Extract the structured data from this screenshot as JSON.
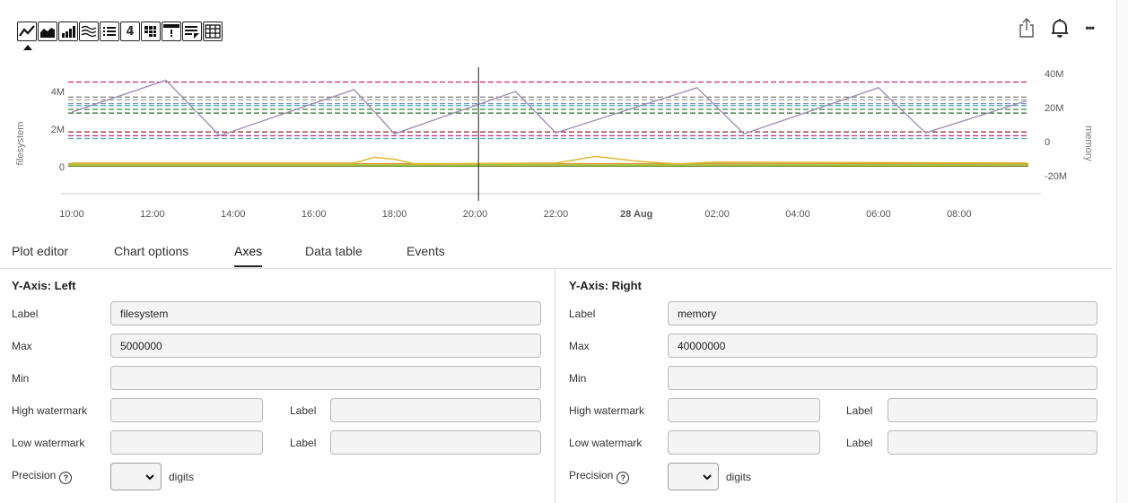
{
  "toolbar": {
    "buttons": [
      {
        "icon": "line-chart-icon"
      },
      {
        "icon": "area-chart-icon"
      },
      {
        "icon": "column-chart-icon"
      },
      {
        "icon": "heatmap-icon"
      },
      {
        "icon": "list-icon"
      },
      {
        "icon": "single-value-icon",
        "text": "4"
      },
      {
        "icon": "grid-icon"
      },
      {
        "icon": "alert-icon"
      },
      {
        "icon": "text-note-icon"
      },
      {
        "icon": "table-icon"
      }
    ],
    "selected_index": 0
  },
  "top_actions": [
    {
      "icon": "share-icon"
    },
    {
      "icon": "bell-icon"
    },
    {
      "icon": "more-icon",
      "text": "•••"
    }
  ],
  "chart_data": {
    "type": "line",
    "x_ticks": [
      "10:00",
      "12:00",
      "14:00",
      "16:00",
      "18:00",
      "20:00",
      "22:00",
      "28 Aug",
      "02:00",
      "04:00",
      "06:00",
      "08:00"
    ],
    "y_left": {
      "label": "filesystem",
      "ticks": [
        "4M",
        "2M",
        "0"
      ],
      "ylim": [
        0,
        5000000
      ]
    },
    "y_right": {
      "label": "memory",
      "ticks": [
        "40M",
        "20M",
        "0",
        "-20M"
      ],
      "ylim": [
        -20000000,
        40000000
      ]
    },
    "cursor_x": "20:00",
    "grid": false,
    "dashed_series": [
      {
        "color": "#c0287e",
        "y": 4500000
      },
      {
        "color": "#8c8c8c",
        "y": 3700000
      },
      {
        "color": "#a7a7a7",
        "y": 3550000
      },
      {
        "color": "#6f8fcf",
        "y": 3350000
      },
      {
        "color": "#4fa6b8",
        "y": 3250000
      },
      {
        "color": "#4b8f4b",
        "y": 3050000
      },
      {
        "color": "#2e6b2e",
        "y": 2850000
      },
      {
        "color": "#8b2a2a",
        "y": 1850000
      },
      {
        "color": "#c0287e",
        "y": 1650000
      },
      {
        "color": "#4fa6b8",
        "y": 1500000
      }
    ],
    "sawtooth": {
      "color": "#a58fb3",
      "x": [
        "10:00",
        "12:20",
        "13:40",
        "17:00",
        "18:00",
        "21:00",
        "22:00",
        "25:30",
        "26:40",
        "30:00",
        "31:10",
        "33:40"
      ],
      "y": [
        2900000,
        4600000,
        1650000,
        4100000,
        1750000,
        4000000,
        1800000,
        4200000,
        1750000,
        4200000,
        1800000,
        3500000
      ]
    },
    "flat_series": [
      {
        "color": "#6c8a1f",
        "y": 50000
      },
      {
        "color": "#d98c2a",
        "y": 150000
      },
      {
        "color": "#b0c24a",
        "y": 100000
      }
    ],
    "spiky": {
      "color": "#d9b52a",
      "x": [
        "10:00",
        "17:00",
        "17:30",
        "18:00",
        "18:30",
        "22:00",
        "23:00",
        "24:00",
        "25:00",
        "26:00",
        "33:40"
      ],
      "y": [
        200000,
        200000,
        500000,
        400000,
        150000,
        200000,
        550000,
        300000,
        150000,
        250000,
        200000
      ]
    }
  },
  "tabs": [
    {
      "label": "Plot editor",
      "active": false
    },
    {
      "label": "Chart options",
      "active": false
    },
    {
      "label": "Axes",
      "active": true
    },
    {
      "label": "Data table",
      "active": false
    },
    {
      "label": "Events",
      "active": false
    }
  ],
  "left_axis": {
    "title": "Y-Axis: Left",
    "label_caption": "Label",
    "label_value": "filesystem",
    "max_caption": "Max",
    "max_value": "5000000",
    "min_caption": "Min",
    "min_value": "",
    "high_caption": "High watermark",
    "high_value": "",
    "high_label_caption": "Label",
    "high_label_value": "",
    "low_caption": "Low watermark",
    "low_value": "",
    "low_label_caption": "Label",
    "low_label_value": "",
    "precision_caption": "Precision",
    "precision_value": "",
    "digits_caption": "digits"
  },
  "right_axis": {
    "title": "Y-Axis: Right",
    "label_caption": "Label",
    "label_value": "memory",
    "max_caption": "Max",
    "max_value": "40000000",
    "min_caption": "Min",
    "min_value": "",
    "high_caption": "High watermark",
    "high_value": "",
    "high_label_caption": "Label",
    "high_label_value": "",
    "low_caption": "Low watermark",
    "low_value": "",
    "low_label_caption": "Label",
    "low_label_value": "",
    "precision_caption": "Precision",
    "precision_value": "",
    "digits_caption": "digits"
  }
}
